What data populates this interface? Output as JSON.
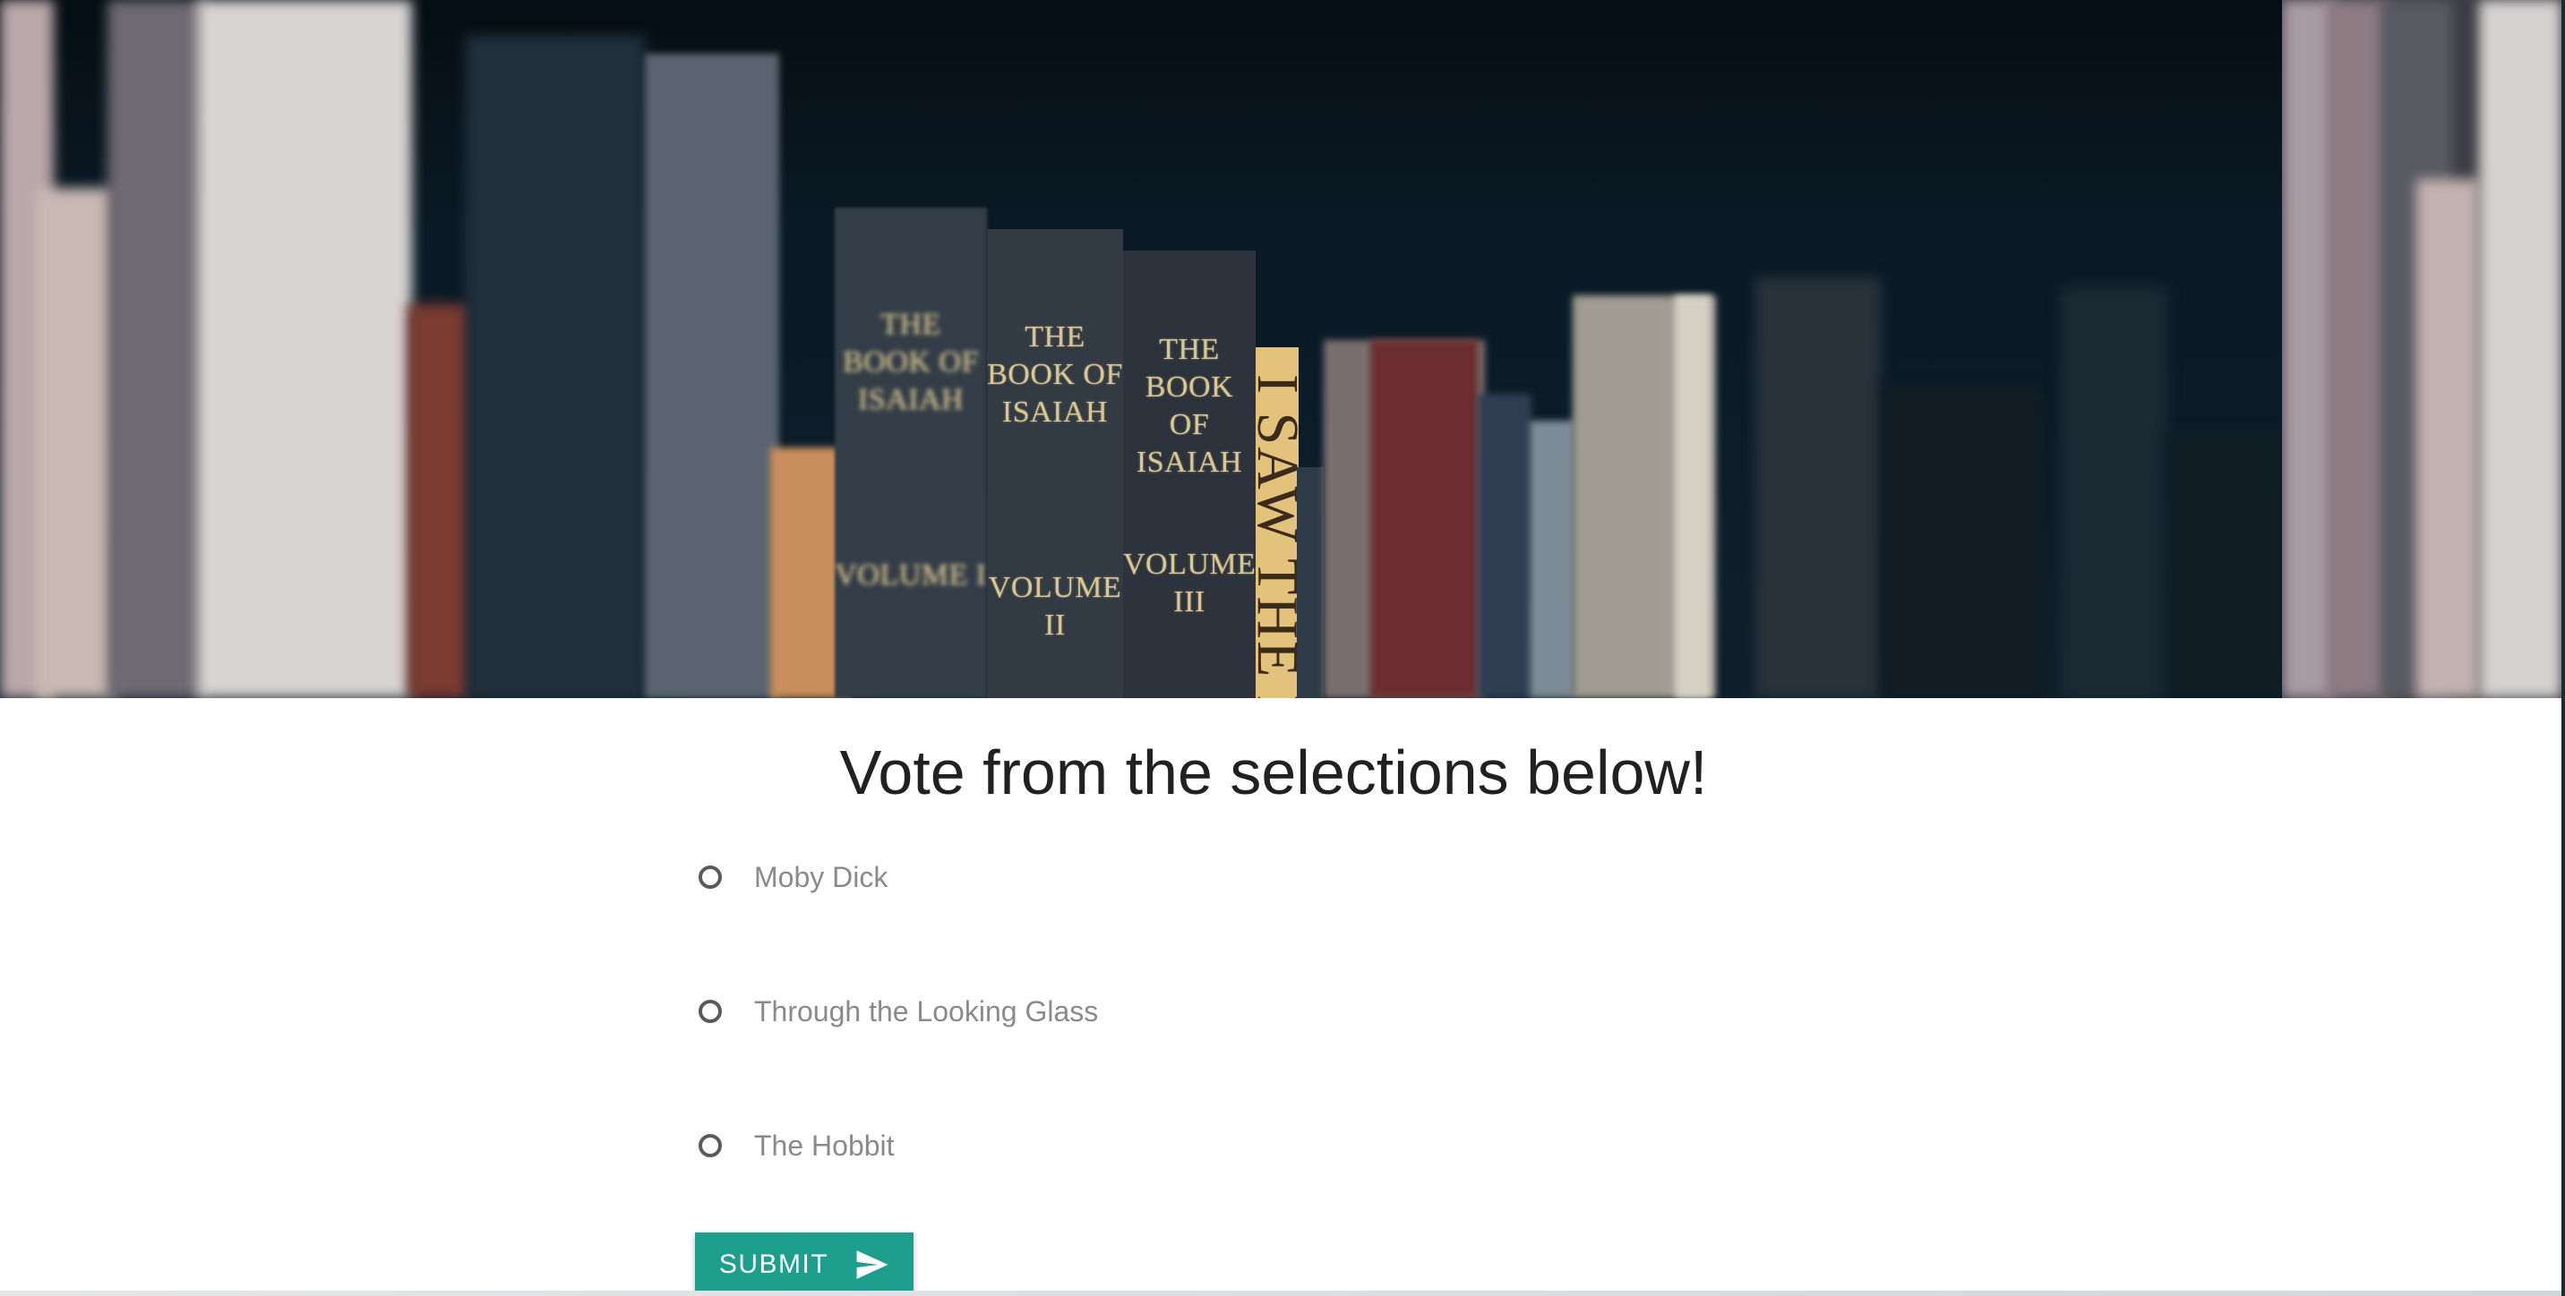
{
  "hero": {
    "spines": [
      {
        "title": "THE BOOK OF ISAIAH",
        "volume": "VOLUME I"
      },
      {
        "title": "THE BOOK OF ISAIAH",
        "volume": "VOLUME II"
      },
      {
        "title": "THE BOOK OF ISAIAH",
        "volume": "VOLUME III"
      },
      {
        "title": "I SAW THE L"
      }
    ]
  },
  "poll": {
    "heading": "Vote from the selections below!",
    "options": [
      {
        "label": "Moby Dick"
      },
      {
        "label": "Through the Looking Glass"
      },
      {
        "label": "The Hobbit"
      }
    ],
    "submit_label": "SUBMIT"
  },
  "colors": {
    "accent": "#1e9e8d",
    "heading_text": "#212121",
    "option_text": "#8a8a8a"
  },
  "icons": {
    "submit": "send-icon"
  }
}
